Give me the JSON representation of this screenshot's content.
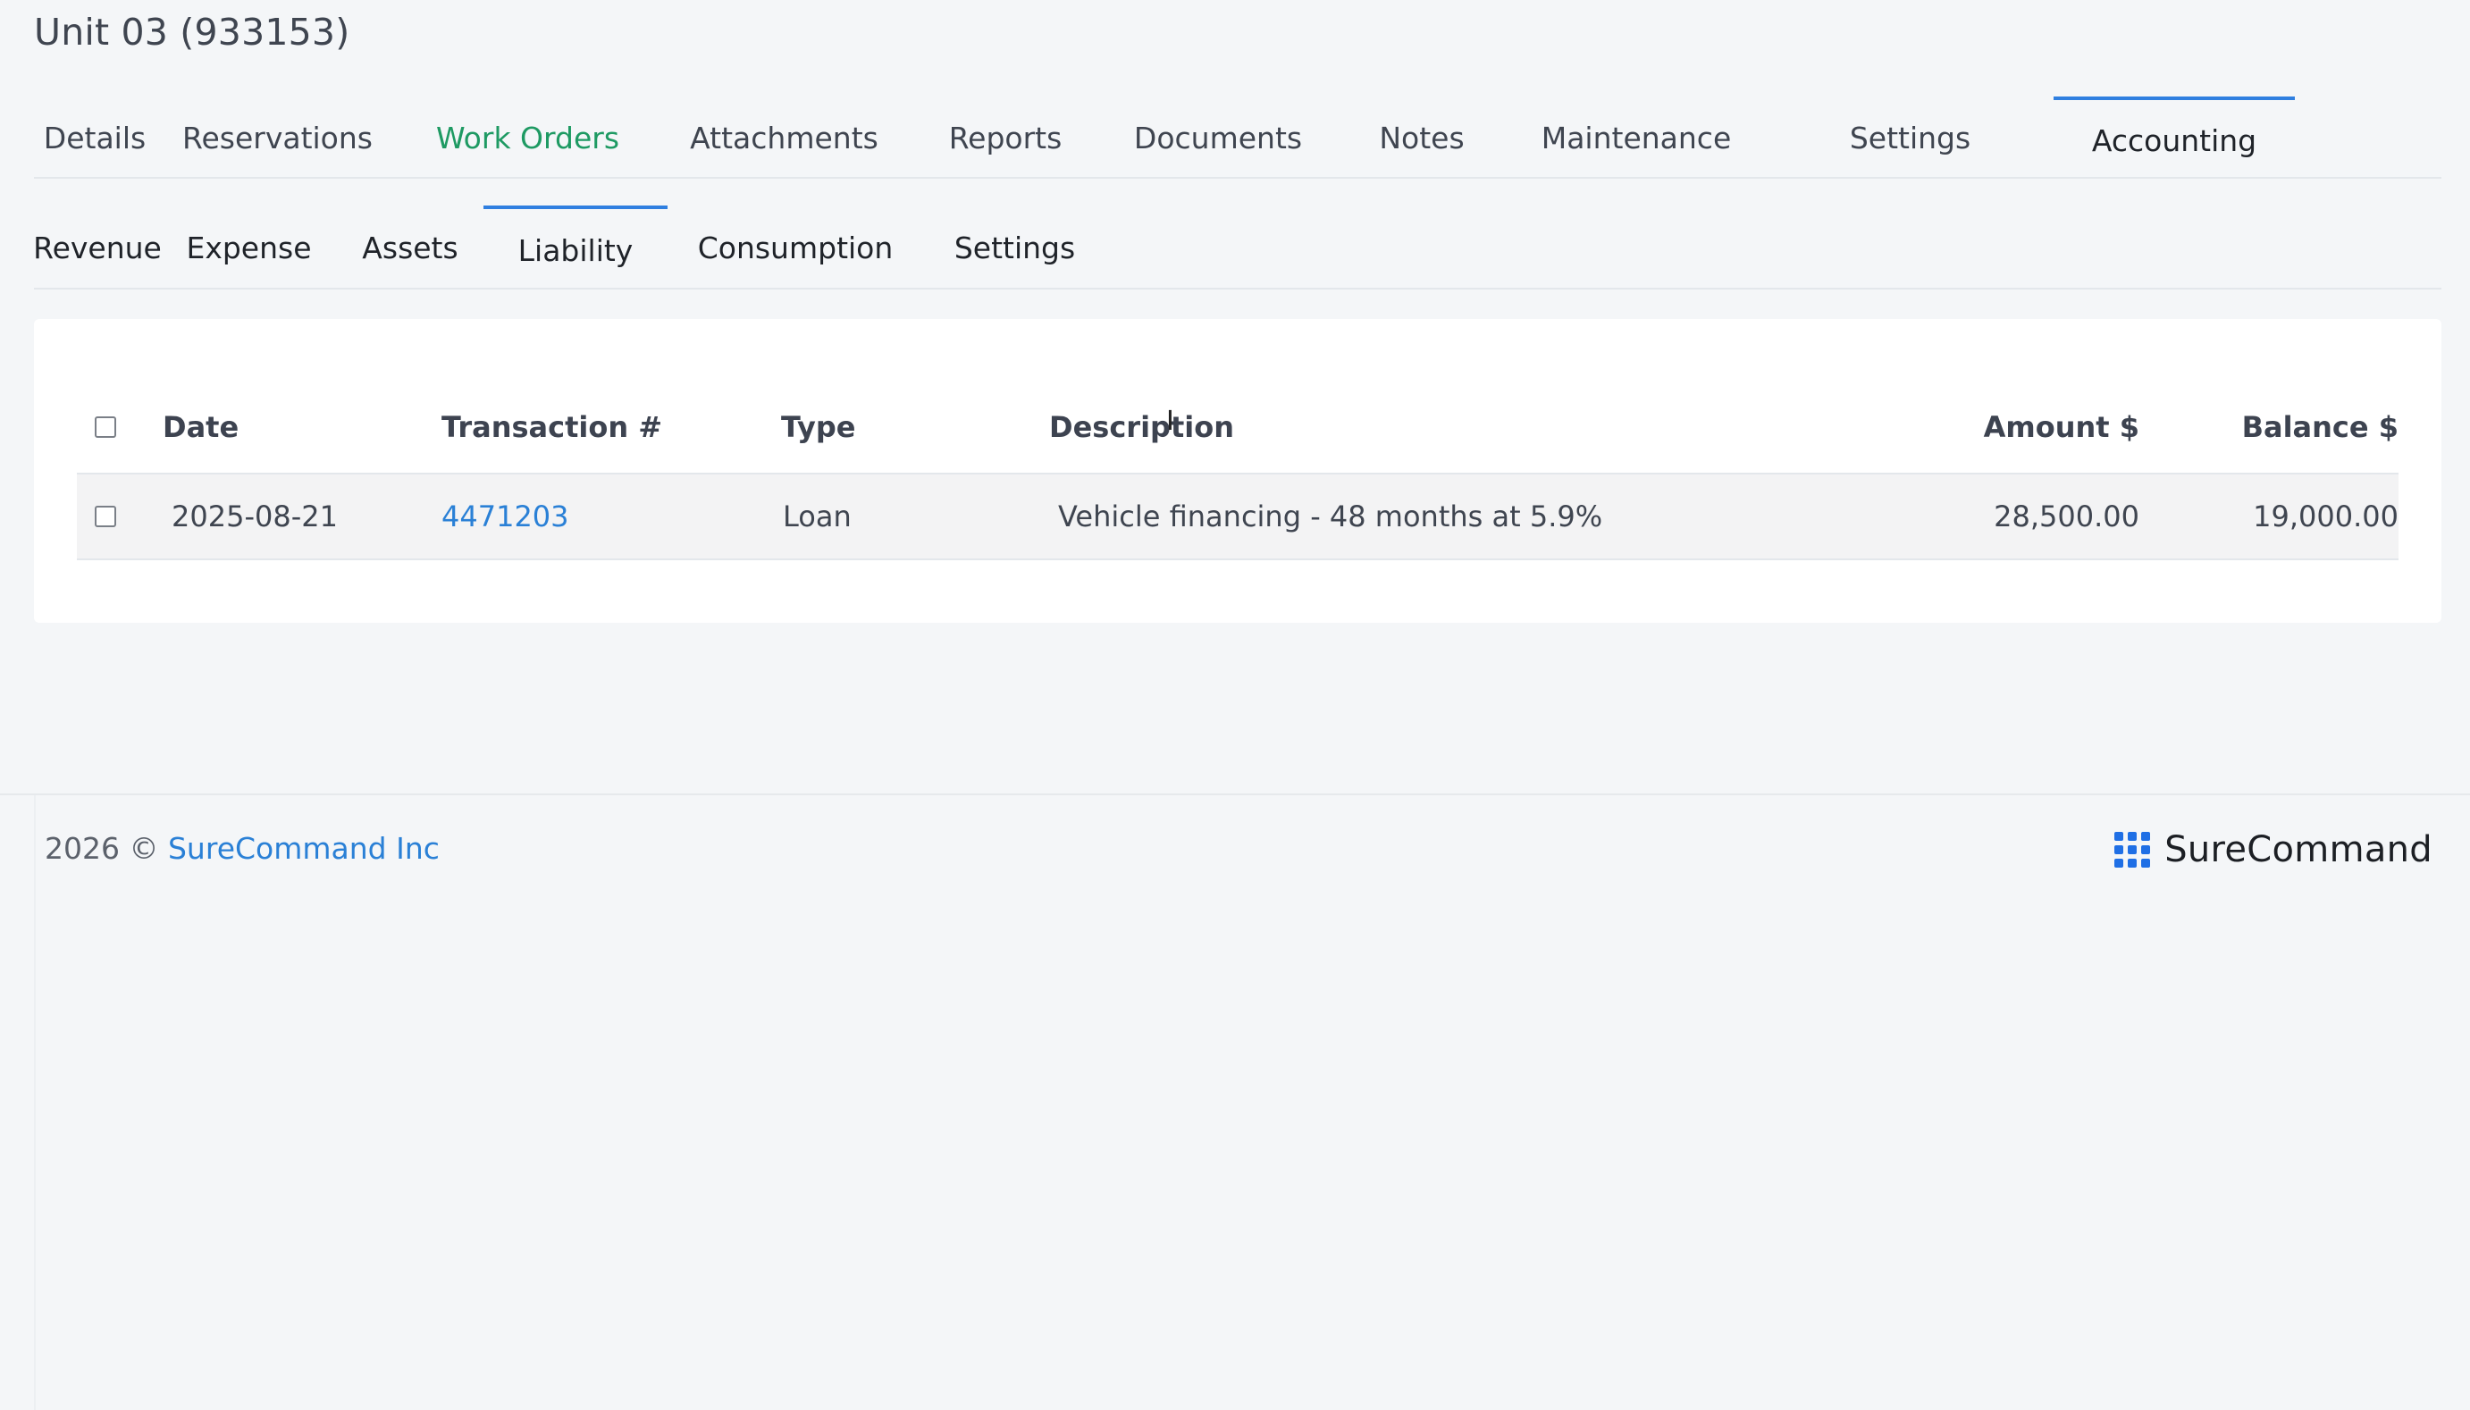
{
  "page": {
    "title": "Unit 03 (933153)"
  },
  "tabs_primary": [
    {
      "label": "Details"
    },
    {
      "label": "Reservations"
    },
    {
      "label": "Work Orders"
    },
    {
      "label": "Attachments"
    },
    {
      "label": "Reports"
    },
    {
      "label": "Documents"
    },
    {
      "label": "Notes"
    },
    {
      "label": "Maintenance"
    },
    {
      "label": "Settings"
    },
    {
      "label": "Accounting"
    }
  ],
  "tabs_secondary": [
    {
      "label": "Revenue"
    },
    {
      "label": "Expense"
    },
    {
      "label": "Assets"
    },
    {
      "label": "Liability"
    },
    {
      "label": "Consumption"
    },
    {
      "label": "Settings"
    }
  ],
  "table": {
    "headers": {
      "date": "Date",
      "transaction": "Transaction #",
      "type": "Type",
      "description": "Description",
      "amount": "Amount $",
      "balance": "Balance $"
    },
    "rows": [
      {
        "date": "2025-08-21",
        "transaction": "4471203",
        "type": "Loan",
        "description": "Vehicle financing - 48 months at 5.9%",
        "amount": "28,500.00",
        "balance": "19,000.00"
      }
    ]
  },
  "footer": {
    "copyright": "2026 ©",
    "company_link": "SureCommand Inc",
    "brand_name": "SureCommand"
  },
  "colors": {
    "accent_blue": "#2f7fe0",
    "link_blue": "#2a80d6",
    "green_tab": "#1e9a63",
    "brand_blue": "#1f6fe5"
  }
}
